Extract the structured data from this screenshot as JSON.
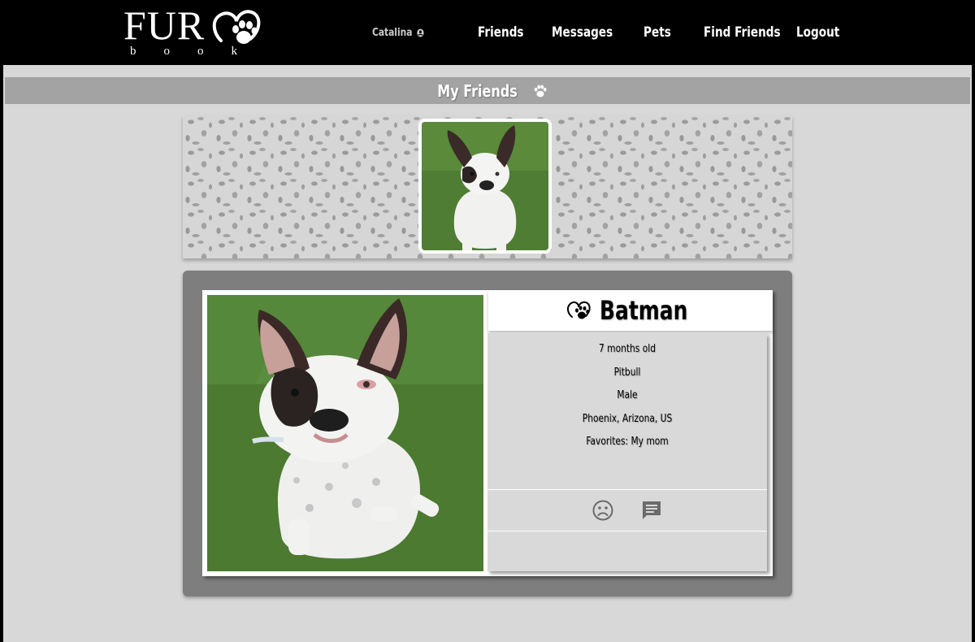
{
  "logo": {
    "brand_top": "FUR",
    "brand_bottom": "book"
  },
  "nav": {
    "user": "Catalina",
    "links": [
      "Friends",
      "Messages",
      "Pets",
      "Find Friends",
      "Logout"
    ]
  },
  "page": {
    "title": "My Friends"
  },
  "pet": {
    "name": "Batman",
    "age": "7 months old",
    "breed": "Pitbull",
    "gender": "Male",
    "location": "Phoenix, Arizona, US",
    "favorites": "Favorites: My mom"
  },
  "icons": {
    "user": "account-circle-icon",
    "title": "paw-icon",
    "name": "heart-paw-icon",
    "action_1": "sad-face-icon",
    "action_2": "message-icon"
  },
  "colors": {
    "navbar": "#000000",
    "page_bg": "#d8d8d8",
    "title_bar": "#a3a3a3",
    "card_frame": "#7e7e7e",
    "details_bg": "#d9d9d9"
  }
}
